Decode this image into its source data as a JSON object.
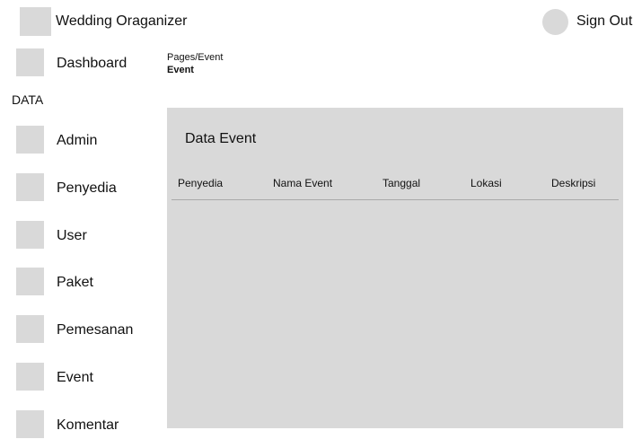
{
  "header": {
    "app_title": "Wedding Oraganizer",
    "sign_out_label": "Sign Out"
  },
  "sidebar": {
    "top_item": {
      "label": "Dashboard",
      "icon": "placeholder-icon"
    },
    "section_label": "DATA",
    "items": [
      {
        "label": "Admin",
        "icon": "placeholder-icon"
      },
      {
        "label": "Penyedia",
        "icon": "placeholder-icon"
      },
      {
        "label": "User",
        "icon": "placeholder-icon"
      },
      {
        "label": "Paket",
        "icon": "placeholder-icon"
      },
      {
        "label": "Pemesanan",
        "icon": "placeholder-icon"
      },
      {
        "label": "Event",
        "icon": "placeholder-icon"
      },
      {
        "label": "Komentar",
        "icon": "placeholder-icon"
      }
    ]
  },
  "breadcrumb": {
    "path": "Pages/Event",
    "current": "Event"
  },
  "main": {
    "panel_title": "Data Event",
    "table": {
      "columns": [
        "Penyedia",
        "Nama Event",
        "Tanggal",
        "Lokasi",
        "Deskripsi"
      ],
      "rows": []
    }
  },
  "colors": {
    "placeholder": "#d9d9d9",
    "panel_background": "#d9d9d9",
    "divider": "#a9a9a9",
    "text": "#111111"
  }
}
